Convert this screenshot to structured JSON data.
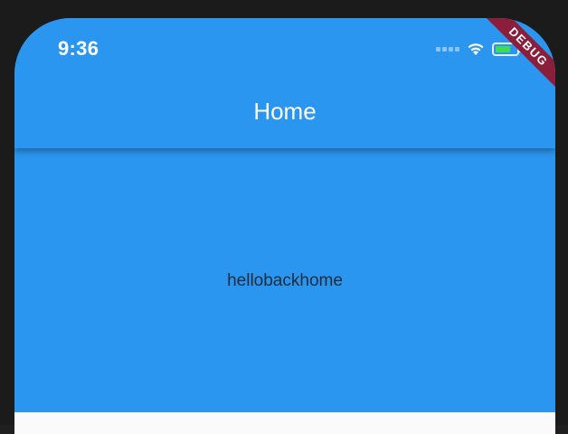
{
  "status_bar": {
    "time": "9:36",
    "icons": {
      "signal": "cellular-signal-icon",
      "wifi": "wifi-icon",
      "battery": "battery-charging-icon"
    }
  },
  "app_bar": {
    "title": "Home"
  },
  "body": {
    "text": "hellobackhome"
  },
  "debug_banner": {
    "label": "DEBUG"
  },
  "colors": {
    "primary": "#2b96ef",
    "debug_banner": "#8b1f3b",
    "battery": "#3ddc53"
  }
}
